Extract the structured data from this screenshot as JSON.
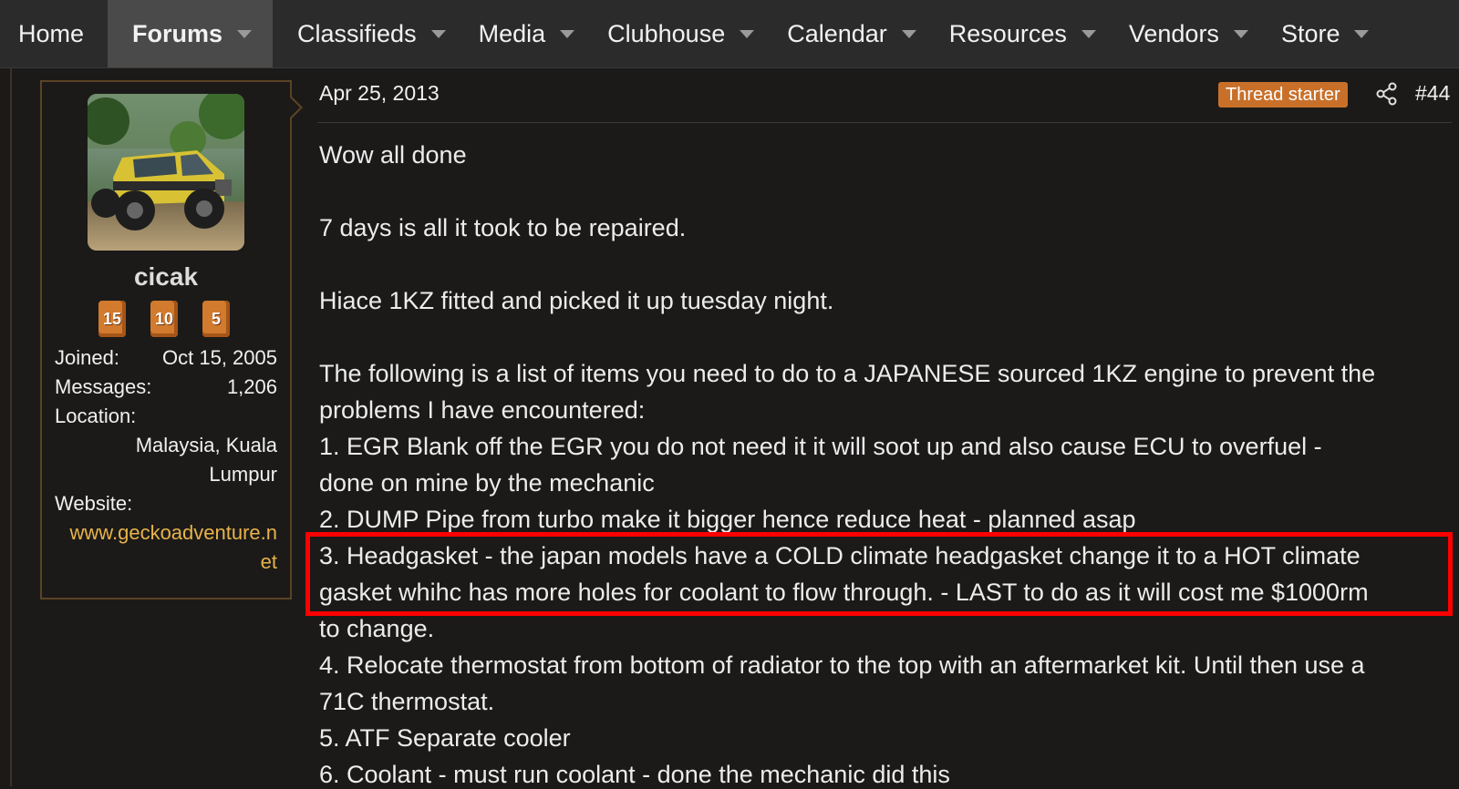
{
  "nav": {
    "items": [
      {
        "label": "Home"
      },
      {
        "label": "Forums"
      },
      {
        "label": "Classifieds"
      },
      {
        "label": "Media"
      },
      {
        "label": "Clubhouse"
      },
      {
        "label": "Calendar"
      },
      {
        "label": "Resources"
      },
      {
        "label": "Vendors"
      },
      {
        "label": "Store"
      }
    ]
  },
  "user": {
    "name": "cicak",
    "badges": [
      "15",
      "10",
      "5"
    ],
    "joined_label": "Joined:",
    "joined_value": "Oct 15, 2005",
    "messages_label": "Messages:",
    "messages_value": "1,206",
    "location_label": "Location:",
    "location_value_1": "Malaysia, Kuala",
    "location_value_2": "Lumpur",
    "website_label": "Website:",
    "website_value_1": "www.geckoadventure.n",
    "website_value_2": "et"
  },
  "post": {
    "date": "Apr 25, 2013",
    "starter_label": "Thread starter",
    "number": "#44",
    "lines": [
      "Wow all done",
      "7 days is all it took to be repaired.",
      "Hiace 1KZ fitted and picked it up tuesday night.",
      "The following is a list of items you need to do to a JAPANESE sourced 1KZ engine to prevent the",
      "problems I have encountered:",
      "1. EGR Blank off the EGR you do not need it it will soot up and also cause ECU to overfuel -",
      "done on mine by the mechanic",
      "2. DUMP Pipe from turbo make it bigger hence reduce heat - planned asap",
      "3. Headgasket - the japan models have a COLD climate headgasket change it to a HOT climate",
      "gasket whihc has more holes for coolant to flow through. - LAST to do as it will cost me $1000rm",
      "to change.",
      "4. Relocate thermostat from bottom of radiator to the top with an aftermarket kit. Until then use a",
      "71C thermostat.",
      "5. ATF Separate cooler",
      "6. Coolant - must run coolant - done the mechanic did this"
    ]
  },
  "colors": {
    "accent": "#c8702a",
    "highlight": "#ff0000",
    "link": "#e8b24a"
  }
}
